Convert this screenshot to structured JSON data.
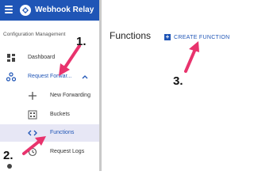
{
  "app": {
    "title": "Webhook Relay"
  },
  "sidebar": {
    "section_title": "Configuration Management",
    "items": [
      {
        "label": "Dashboard",
        "icon": "dashboard-icon"
      },
      {
        "label": "Request Forwar...",
        "icon": "webhook-icon",
        "expanded": true
      },
      {
        "label": "New Forwarding",
        "icon": "plus-icon"
      },
      {
        "label": "Buckets",
        "icon": "buckets-icon"
      },
      {
        "label": "Functions",
        "icon": "code-icon",
        "active": true
      },
      {
        "label": "Request Logs",
        "icon": "history-icon"
      }
    ]
  },
  "main": {
    "title": "Functions",
    "create_button": "CREATE FUNCTION"
  },
  "annotations": {
    "one": "1.",
    "two": "2.",
    "three": "3."
  },
  "colors": {
    "brand": "#1f55b6",
    "arrow": "#e8336d",
    "active_bg": "#e7e7f5"
  }
}
